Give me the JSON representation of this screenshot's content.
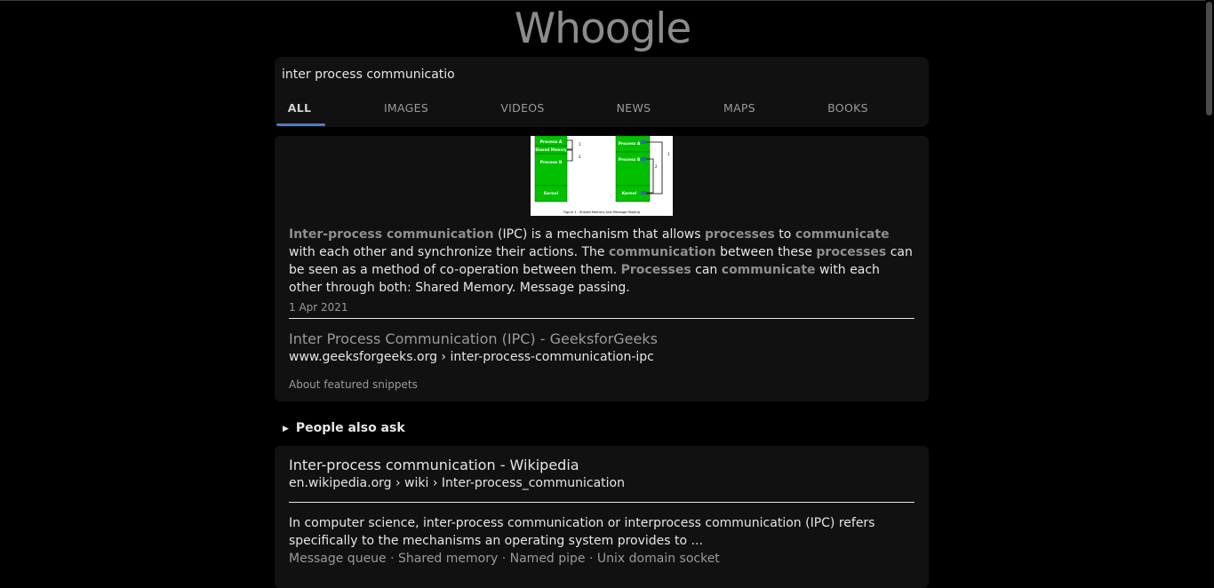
{
  "logo": "Whoogle",
  "search": {
    "value": "inter process communicatio"
  },
  "tabs": [
    {
      "label": "ALL"
    },
    {
      "label": "IMAGES"
    },
    {
      "label": "VIDEOS"
    },
    {
      "label": "NEWS"
    },
    {
      "label": "MAPS"
    },
    {
      "label": "BOOKS"
    }
  ],
  "featured": {
    "diagram": {
      "caption": "Figure 1 - Shared Memory and Message Passing",
      "left": [
        "Process A",
        "Shared Memory",
        "Process B",
        "Kernel"
      ],
      "right": [
        "Process A",
        "Process B",
        "Kernel"
      ],
      "fill_color": "#00c000"
    },
    "snippet": {
      "s1": "Inter-process communication",
      "s2": " (IPC) is a mechanism that allows ",
      "s3": "processes",
      "s4": " to ",
      "s5": "communicate",
      "s6": " with each other and synchronize their actions. The ",
      "s7": "communication",
      "s8": " between these ",
      "s9": "processes",
      "s10": " can be seen as a method of co-operation between them. ",
      "s11": "Processes",
      "s12": " can ",
      "s13": "communicate",
      "s14": " with each other through both: Shared Memory. Message passing."
    },
    "date": "1 Apr 2021",
    "title": "Inter Process Communication (IPC) - GeeksforGeeks",
    "url": "www.geeksforgeeks.org › inter-process-communication-ipc",
    "about": "About featured snippets"
  },
  "people_also_ask": "People also ask",
  "wiki": {
    "title": "Inter-process communication - Wikipedia",
    "url": "en.wikipedia.org › wiki › Inter-process_communication",
    "snippet": "In computer science, inter-process communication or interprocess communication (IPC) refers specifically to the mechanisms an operating system provides to ...",
    "links": [
      "Message queue",
      "Shared memory",
      "Named pipe",
      "Unix domain socket"
    ],
    "sep": " · "
  },
  "colors": {
    "background": "#000000",
    "card": "#111111",
    "tab_accent": "#4a7cc9",
    "highlight": "#8f8f8f"
  }
}
